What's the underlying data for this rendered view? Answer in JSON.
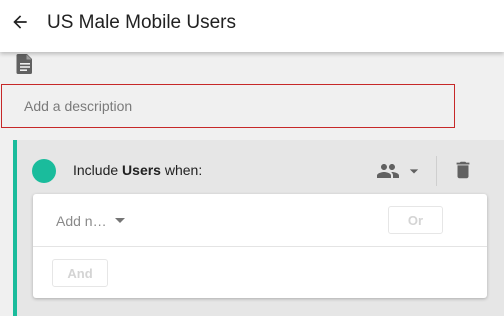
{
  "header": {
    "title": "US Male Mobile Users",
    "back_icon": "arrow-back-icon"
  },
  "description": {
    "icon": "document-icon",
    "placeholder": "Add a description",
    "value": ""
  },
  "rule": {
    "accent_color": "#1abc9c",
    "include_prefix": "Include",
    "entity": "Users",
    "include_suffix": "when:",
    "audience_icon": "people-icon",
    "delete_icon": "trash-icon"
  },
  "conditions": {
    "add_name_label": "Add n…",
    "or_label": "Or",
    "and_label": "And"
  }
}
